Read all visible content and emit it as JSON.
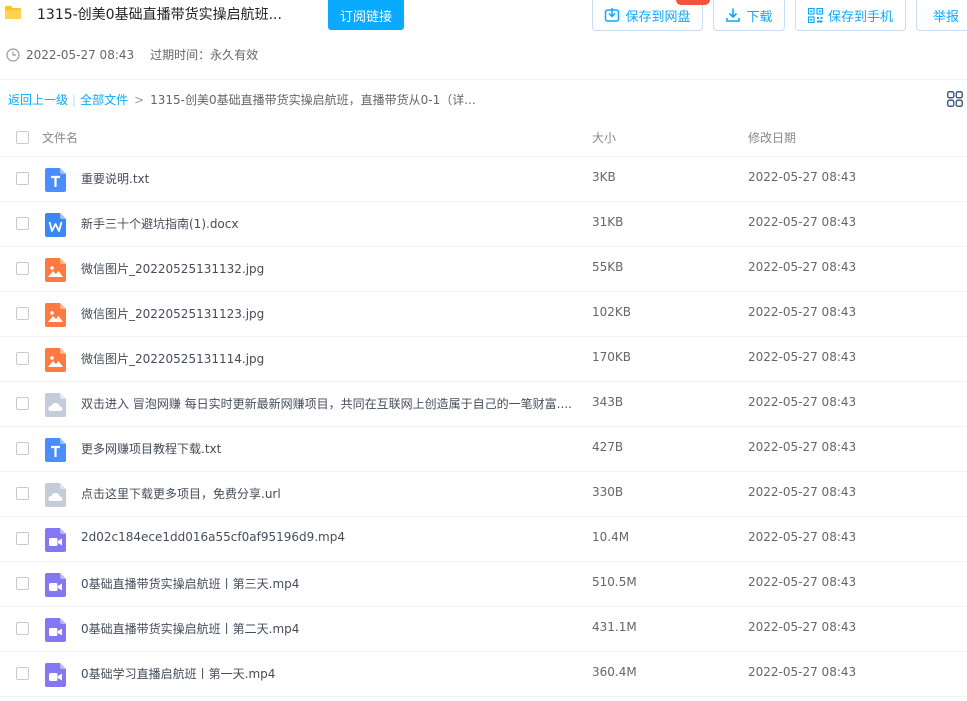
{
  "header": {
    "title": "1315-创美0基础直播带货实操启航班...",
    "subscribe_label": "订阅链接",
    "save_to_disk_label": "保存到网盘",
    "download_label": "下载",
    "save_to_phone_label": "保存到手机",
    "report_label": "举报",
    "date": "2022-05-27 08:43",
    "expiry": "过期时间：永久有效"
  },
  "breadcrumb": {
    "back": "返回上一级",
    "all": "全部文件",
    "divider": "|",
    "arrow": ">",
    "current": "1315-创美0基础直播带货实操启航班，直播带货从0-1（详..."
  },
  "table": {
    "headers": {
      "name": "文件名",
      "size": "大小",
      "date": "修改日期"
    },
    "rows": [
      {
        "icon": "txt-file-icon",
        "name": "重要说明.txt",
        "size": "3KB",
        "date": "2022-05-27 08:43"
      },
      {
        "icon": "word-file-icon",
        "name": "新手三十个避坑指南(1).docx",
        "size": "31KB",
        "date": "2022-05-27 08:43"
      },
      {
        "icon": "image-file-icon",
        "name": "微信图片_20220525131132.jpg",
        "size": "55KB",
        "date": "2022-05-27 08:43"
      },
      {
        "icon": "image-file-icon",
        "name": "微信图片_20220525131123.jpg",
        "size": "102KB",
        "date": "2022-05-27 08:43"
      },
      {
        "icon": "image-file-icon",
        "name": "微信图片_20220525131114.jpg",
        "size": "170KB",
        "date": "2022-05-27 08:43"
      },
      {
        "icon": "cloud-file-icon",
        "name": "双击进入 冒泡网赚 每日实时更新最新网赚项目，共同在互联网上创造属于自己的一笔财富....",
        "size": "343B",
        "date": "2022-05-27 08:43"
      },
      {
        "icon": "txt-file-icon",
        "name": "更多网赚项目教程下载.txt",
        "size": "427B",
        "date": "2022-05-27 08:43"
      },
      {
        "icon": "cloud-file-icon",
        "name": "点击这里下载更多项目，免费分享.url",
        "size": "330B",
        "date": "2022-05-27 08:43"
      },
      {
        "icon": "video-file-icon",
        "name": "2d02c184ece1dd016a55cf0af95196d9.mp4",
        "size": "10.4M",
        "date": "2022-05-27 08:43"
      },
      {
        "icon": "video-file-icon",
        "name": "0基础直播带货实操启航班丨第三天.mp4",
        "size": "510.5M",
        "date": "2022-05-27 08:43"
      },
      {
        "icon": "video-file-icon",
        "name": "0基础直播带货实操启航班丨第二天.mp4",
        "size": "431.1M",
        "date": "2022-05-27 08:43"
      },
      {
        "icon": "video-file-icon",
        "name": "0基础学习直播启航班丨第一天.mp4",
        "size": "360.4M",
        "date": "2022-05-27 08:43"
      }
    ]
  },
  "colors": {
    "accent": "#09aaff",
    "txt_icon": "#4a8dff",
    "word_icon": "#3b88f5",
    "image_icon": "#fe7a40",
    "cloud_icon": "#c3ccd8",
    "video_icon": "#8478f2",
    "badge": "#f5533d"
  }
}
